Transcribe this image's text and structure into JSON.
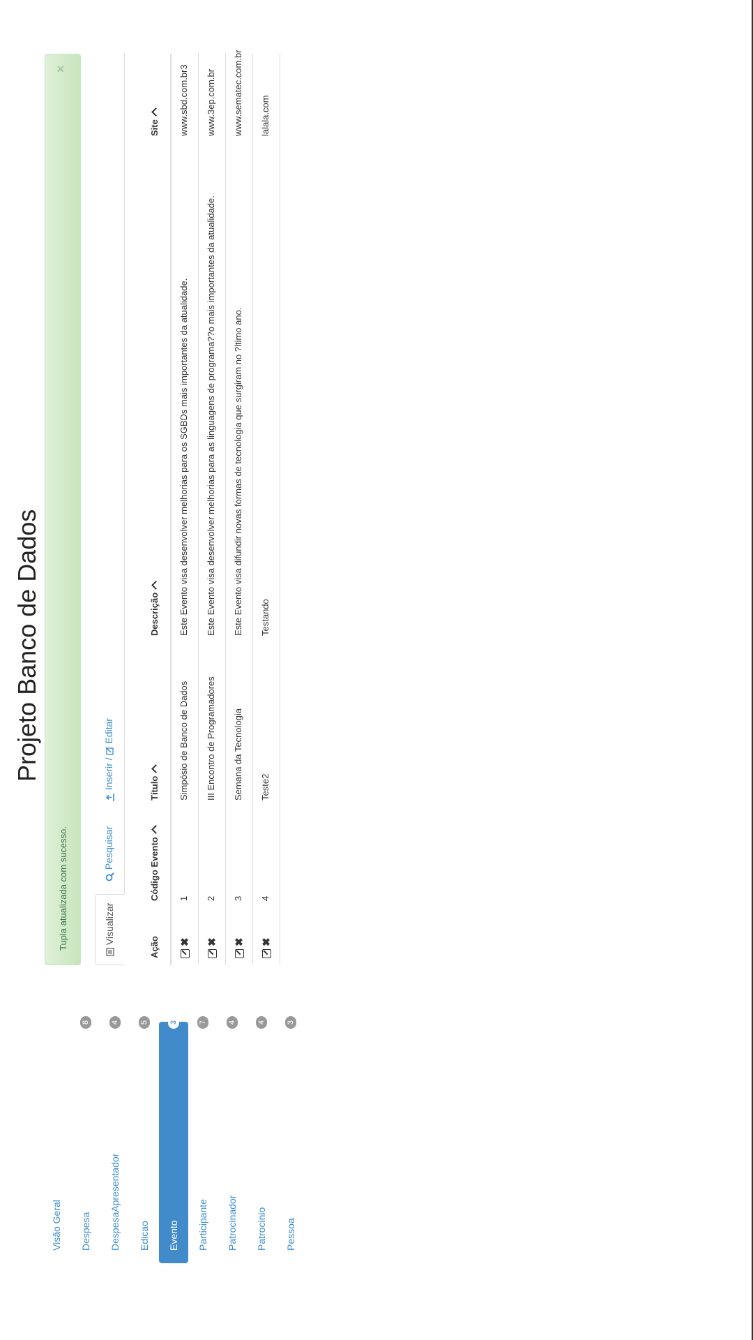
{
  "app": {
    "title": "Projeto Banco de Dados"
  },
  "sidebar": {
    "items": [
      {
        "label": "Visão Geral",
        "badge": ""
      },
      {
        "label": "Despesa",
        "badge": "8"
      },
      {
        "label": "DespesaApresentador",
        "badge": "4"
      },
      {
        "label": "Edicao",
        "badge": "5"
      },
      {
        "label": "Evento",
        "badge": "3"
      },
      {
        "label": "Participante",
        "badge": "7"
      },
      {
        "label": "Patrocinador",
        "badge": "4"
      },
      {
        "label": "Patrocinio",
        "badge": "4"
      },
      {
        "label": "Pessoa",
        "badge": "3"
      }
    ],
    "active_index": 4
  },
  "alert": {
    "message": "Tupla atualizada com sucesso.",
    "close_symbol": "×"
  },
  "tabs": {
    "view": "Visualizar",
    "search": "Pesquisar",
    "insert_edit": "Inserir / ",
    "edit": "Editar"
  },
  "table": {
    "headers": {
      "action": "Ação",
      "code": "Código Evento",
      "title": "Título",
      "description": "Descrição",
      "site": "Site"
    },
    "rows": [
      {
        "code": "1",
        "title": "Simpósio de Banco de Dados",
        "description": "Este Evento visa desenvolver melhorias para os SGBDs mais importantes da atualidade.",
        "site": "www.sbd.com.br3"
      },
      {
        "code": "2",
        "title": "III Encontro de Programadores",
        "description": "Este Evento visa desenvolver melhorias para as linguagens de programa??o mais importantes da atualidade.",
        "site": "www.3ep.com.br"
      },
      {
        "code": "3",
        "title": "Semana da Tecnologia",
        "description": "Este Evento visa difundir novas formas de tecnologia que surgiram no ?ltimo ano.",
        "site": "www.sematec.com.br"
      },
      {
        "code": "4",
        "title": "Teste2",
        "description": "Testando",
        "site": "lalala.com"
      }
    ]
  },
  "colors": {
    "accent": "#428bca",
    "link": "#3c8dcd",
    "alert_bg": "#dff0d8",
    "alert_text": "#3c763d"
  }
}
